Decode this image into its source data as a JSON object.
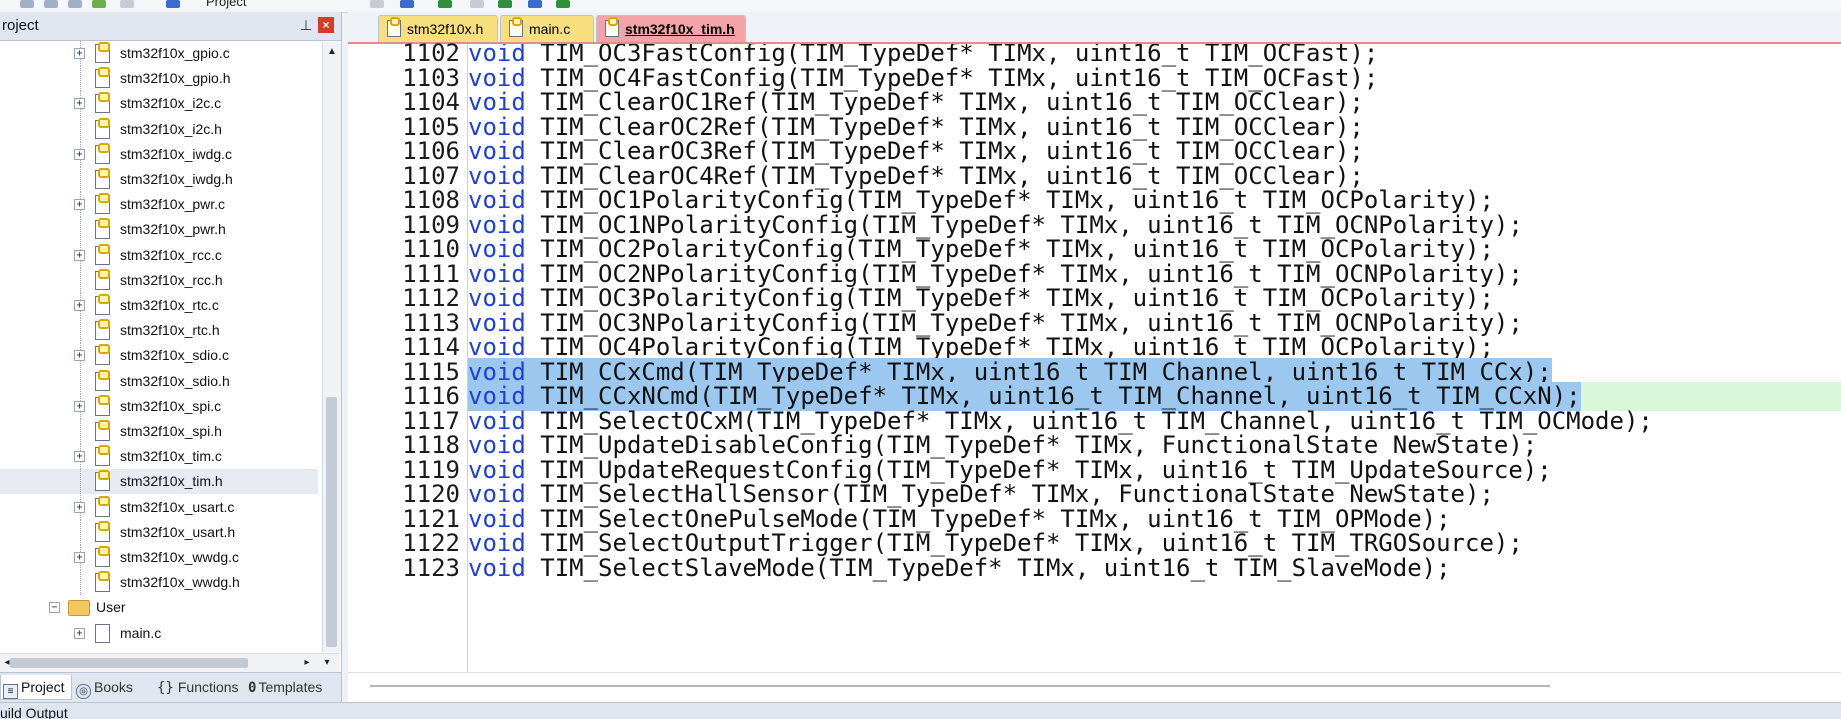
{
  "toolbar": {
    "target_label": "Project"
  },
  "project_panel": {
    "title": "roject",
    "tree": [
      {
        "label": "stm32f10x_gpio.c",
        "expandable": true
      },
      {
        "label": "stm32f10x_gpio.h",
        "expandable": false
      },
      {
        "label": "stm32f10x_i2c.c",
        "expandable": true
      },
      {
        "label": "stm32f10x_i2c.h",
        "expandable": false
      },
      {
        "label": "stm32f10x_iwdg.c",
        "expandable": true
      },
      {
        "label": "stm32f10x_iwdg.h",
        "expandable": false
      },
      {
        "label": "stm32f10x_pwr.c",
        "expandable": true
      },
      {
        "label": "stm32f10x_pwr.h",
        "expandable": false
      },
      {
        "label": "stm32f10x_rcc.c",
        "expandable": true
      },
      {
        "label": "stm32f10x_rcc.h",
        "expandable": false
      },
      {
        "label": "stm32f10x_rtc.c",
        "expandable": true
      },
      {
        "label": "stm32f10x_rtc.h",
        "expandable": false
      },
      {
        "label": "stm32f10x_sdio.c",
        "expandable": true
      },
      {
        "label": "stm32f10x_sdio.h",
        "expandable": false
      },
      {
        "label": "stm32f10x_spi.c",
        "expandable": true
      },
      {
        "label": "stm32f10x_spi.h",
        "expandable": false
      },
      {
        "label": "stm32f10x_tim.c",
        "expandable": true
      },
      {
        "label": "stm32f10x_tim.h",
        "expandable": false,
        "selected": true
      },
      {
        "label": "stm32f10x_usart.c",
        "expandable": true
      },
      {
        "label": "stm32f10x_usart.h",
        "expandable": false
      },
      {
        "label": "stm32f10x_wwdg.c",
        "expandable": true
      },
      {
        "label": "stm32f10x_wwdg.h",
        "expandable": false
      }
    ],
    "group_user": {
      "label": "User"
    },
    "user_files": [
      {
        "label": "main.c"
      }
    ],
    "tabs": [
      "Project",
      "Books",
      "Functions",
      "Templates"
    ]
  },
  "editor": {
    "tabs": [
      {
        "label": "stm32f10x.h",
        "active": false
      },
      {
        "label": "main.c",
        "active": false
      },
      {
        "label": "stm32f10x_tim.h",
        "active": true
      }
    ],
    "lines": [
      {
        "no": "1102",
        "text": "void TIM_OC3FastConfig(TIM_TypeDef* TIMx, uint16_t TIM_OCFast);"
      },
      {
        "no": "1103",
        "text": "void TIM_OC4FastConfig(TIM_TypeDef* TIMx, uint16_t TIM_OCFast);"
      },
      {
        "no": "1104",
        "text": "void TIM_ClearOC1Ref(TIM_TypeDef* TIMx, uint16_t TIM_OCClear);"
      },
      {
        "no": "1105",
        "text": "void TIM_ClearOC2Ref(TIM_TypeDef* TIMx, uint16_t TIM_OCClear);"
      },
      {
        "no": "1106",
        "text": "void TIM_ClearOC3Ref(TIM_TypeDef* TIMx, uint16_t TIM_OCClear);"
      },
      {
        "no": "1107",
        "text": "void TIM_ClearOC4Ref(TIM_TypeDef* TIMx, uint16_t TIM_OCClear);"
      },
      {
        "no": "1108",
        "text": "void TIM_OC1PolarityConfig(TIM_TypeDef* TIMx, uint16_t TIM_OCPolarity);"
      },
      {
        "no": "1109",
        "text": "void TIM_OC1NPolarityConfig(TIM_TypeDef* TIMx, uint16_t TIM_OCNPolarity);"
      },
      {
        "no": "1110",
        "text": "void TIM_OC2PolarityConfig(TIM_TypeDef* TIMx, uint16_t TIM_OCPolarity);"
      },
      {
        "no": "1111",
        "text": "void TIM_OC2NPolarityConfig(TIM_TypeDef* TIMx, uint16_t TIM_OCNPolarity);"
      },
      {
        "no": "1112",
        "text": "void TIM_OC3PolarityConfig(TIM_TypeDef* TIMx, uint16_t TIM_OCPolarity);"
      },
      {
        "no": "1113",
        "text": "void TIM_OC3NPolarityConfig(TIM_TypeDef* TIMx, uint16_t TIM_OCNPolarity);"
      },
      {
        "no": "1114",
        "text": "void TIM_OC4PolarityConfig(TIM_TypeDef* TIMx, uint16_t TIM_OCPolarity);"
      },
      {
        "no": "1115",
        "text": "void TIM_CCxCmd(TIM_TypeDef* TIMx, uint16_t TIM_Channel, uint16_t TIM_CCx);",
        "selected": true
      },
      {
        "no": "1116",
        "text": "void TIM_CCxNCmd(TIM_TypeDef* TIMx, uint16_t TIM_Channel, uint16_t TIM_CCxN);",
        "selected": true,
        "current": true
      },
      {
        "no": "1117",
        "text": "void TIM_SelectOCxM(TIM_TypeDef* TIMx, uint16_t TIM_Channel, uint16_t TIM_OCMode);"
      },
      {
        "no": "1118",
        "text": "void TIM_UpdateDisableConfig(TIM_TypeDef* TIMx, FunctionalState NewState);"
      },
      {
        "no": "1119",
        "text": "void TIM_UpdateRequestConfig(TIM_TypeDef* TIMx, uint16_t TIM_UpdateSource);"
      },
      {
        "no": "1120",
        "text": "void TIM_SelectHallSensor(TIM_TypeDef* TIMx, FunctionalState NewState);"
      },
      {
        "no": "1121",
        "text": "void TIM_SelectOnePulseMode(TIM_TypeDef* TIMx, uint16_t TIM_OPMode);"
      },
      {
        "no": "1122",
        "text": "void TIM_SelectOutputTrigger(TIM_TypeDef* TIMx, uint16_t TIM_TRGOSource);"
      },
      {
        "no": "1123",
        "text": "void TIM_SelectSlaveMode(TIM_TypeDef* TIMx, uint16_t TIM_SlaveMode);"
      }
    ]
  },
  "build_output": {
    "title": "uild Output"
  },
  "colors": {
    "keyword": "#1f3fd8",
    "selection": "#9cc8f0",
    "current_line": "#d9f7d9",
    "active_tab": "#f4a3a8",
    "inactive_tab": "#f6df7c"
  }
}
